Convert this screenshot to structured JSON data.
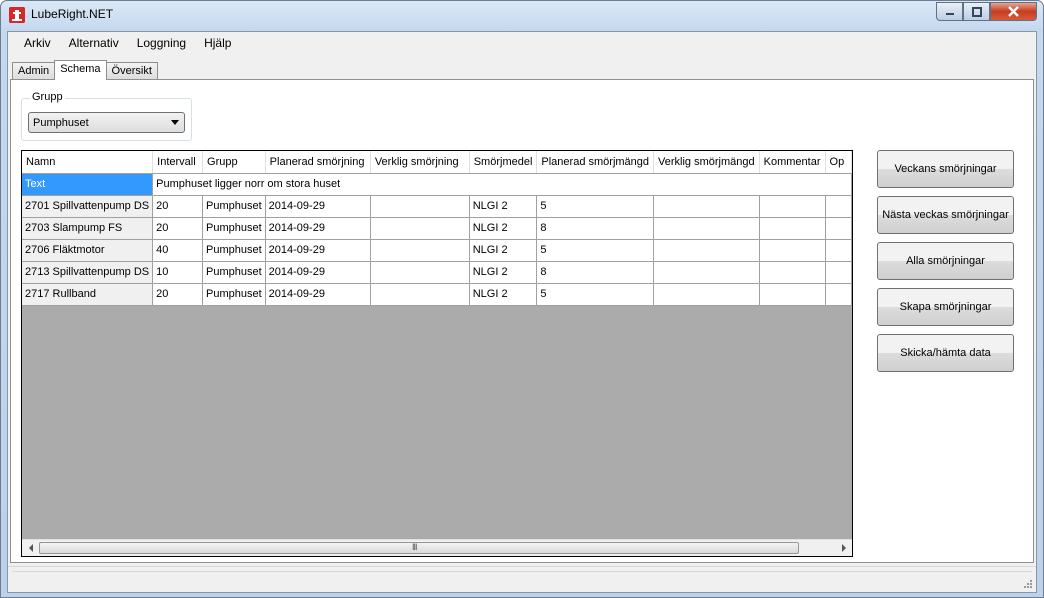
{
  "window": {
    "title": "LubeRight.NET"
  },
  "menu": [
    "Arkiv",
    "Alternativ",
    "Loggning",
    "Hjälp"
  ],
  "tabs": [
    "Admin",
    "Schema",
    "Översikt"
  ],
  "group": {
    "legend": "Grupp",
    "selected": "Pumphuset"
  },
  "grid": {
    "columns": [
      "Namn",
      "Intervall",
      "Grupp",
      "Planerad smörjning",
      "Verklig smörjning",
      "Smörjmedel",
      "Planerad smörjmängd",
      "Verklig smörjmängd",
      "Kommentar",
      "Op"
    ],
    "text_row": {
      "label": "Text",
      "value": "Pumphuset ligger norr om stora huset"
    },
    "rows": [
      {
        "namn": "2701 Spillvattenpump DS",
        "intervall": "20",
        "grupp": "Pumphuset",
        "planerad": "2014-09-29",
        "verklig": "",
        "smorjmedel": "NLGI 2",
        "mangd": "5"
      },
      {
        "namn": "2703 Slampump FS",
        "intervall": "20",
        "grupp": "Pumphuset",
        "planerad": "2014-09-29",
        "verklig": "",
        "smorjmedel": "NLGI 2",
        "mangd": "8"
      },
      {
        "namn": "2706 Fläktmotor",
        "intervall": "40",
        "grupp": "Pumphuset",
        "planerad": "2014-09-29",
        "verklig": "",
        "smorjmedel": "NLGI 2",
        "mangd": "5"
      },
      {
        "namn": "2713 Spillvattenpump DS",
        "intervall": "10",
        "grupp": "Pumphuset",
        "planerad": "2014-09-29",
        "verklig": "",
        "smorjmedel": "NLGI 2",
        "mangd": "8"
      },
      {
        "namn": "2717 Rullband",
        "intervall": "20",
        "grupp": "Pumphuset",
        "planerad": "2014-09-29",
        "verklig": "",
        "smorjmedel": "NLGI 2",
        "mangd": "5"
      }
    ],
    "scroll_grip": "III"
  },
  "buttons": [
    "Veckans smörjningar",
    "Nästa veckas smörjningar",
    "Alla smörjningar",
    "Skapa smörjningar",
    "Skicka/hämta data"
  ],
  "icons": {
    "app": "oil-can-icon",
    "minimize": "minimize-icon",
    "maximize": "maximize-icon",
    "close": "close-icon"
  },
  "colors": {
    "selection": "#3399ff",
    "grid_background": "#ababab"
  }
}
